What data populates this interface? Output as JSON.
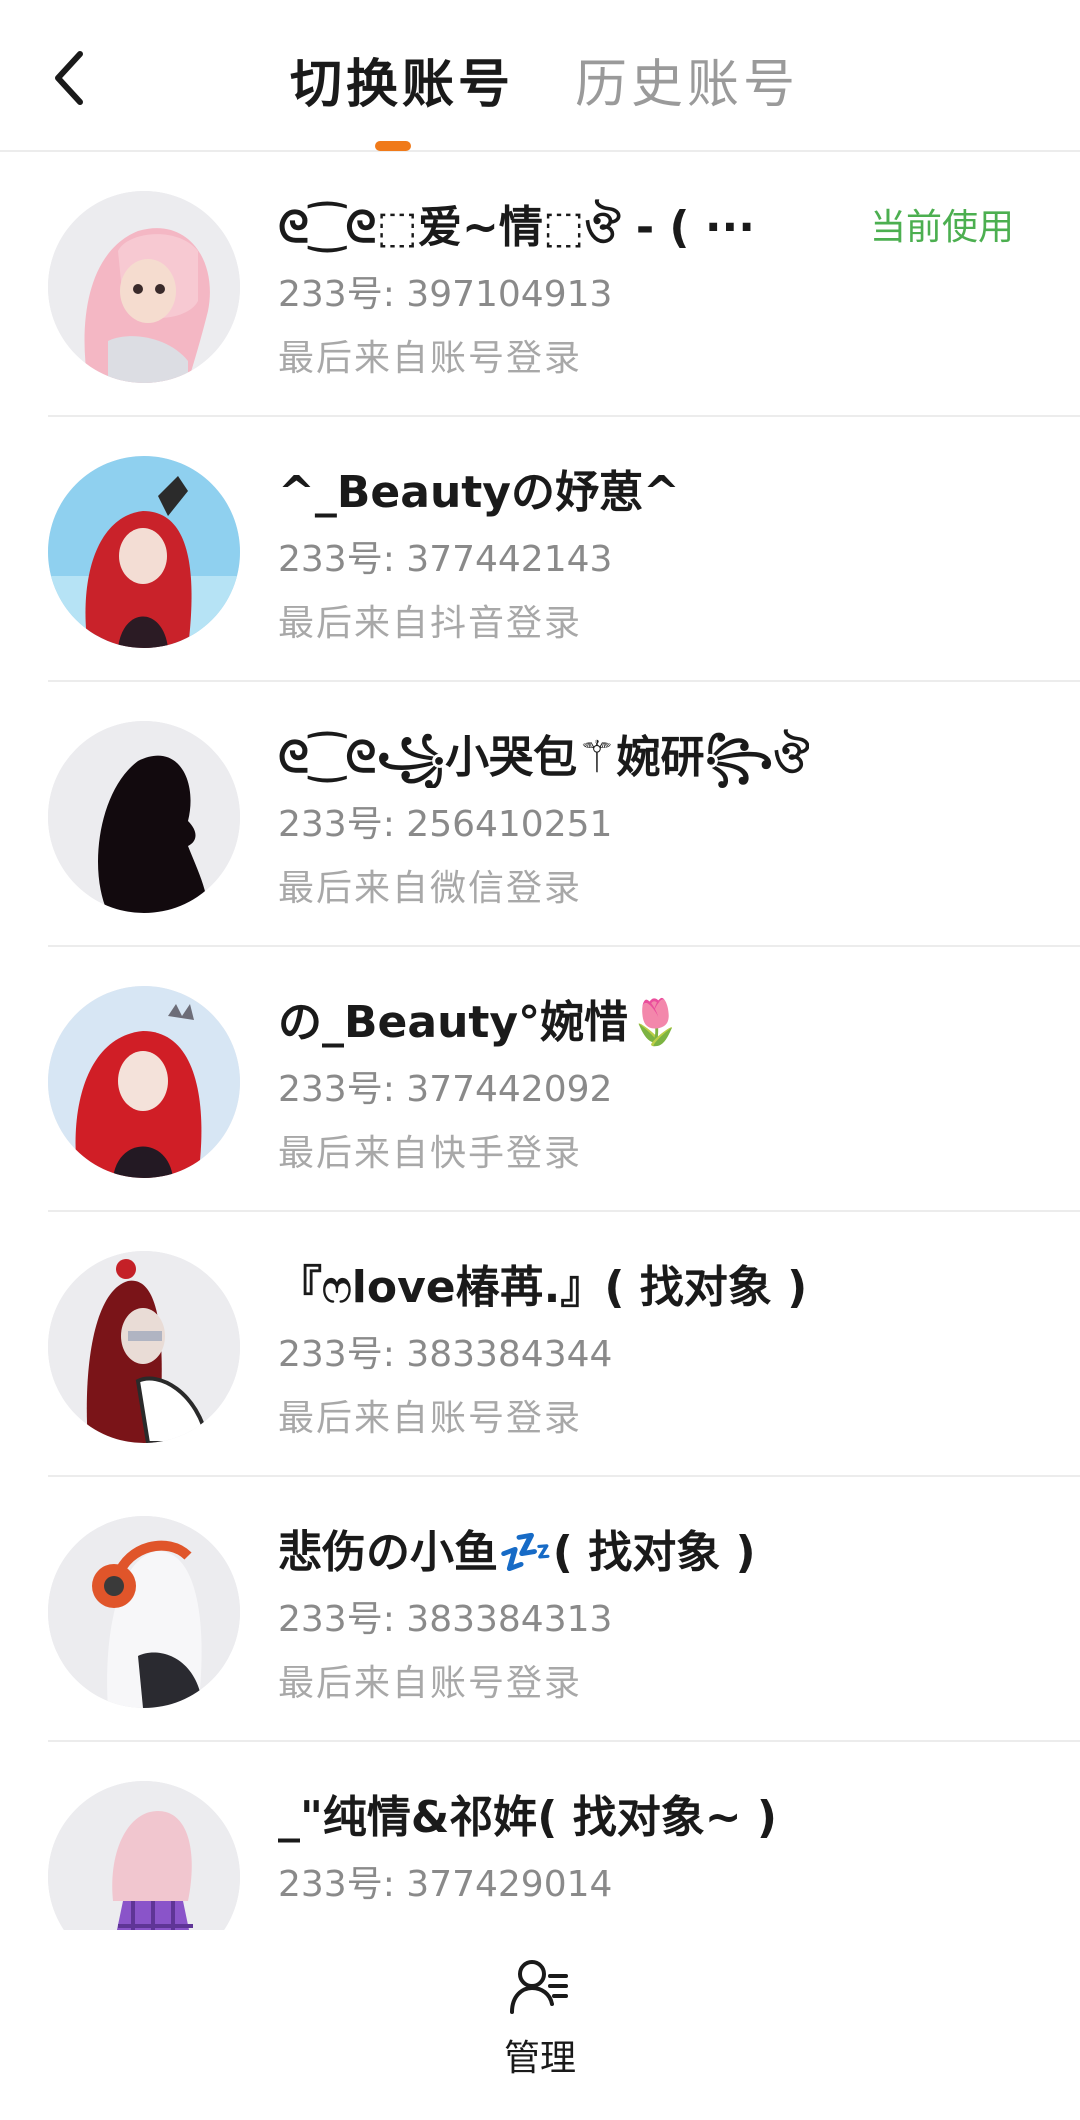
{
  "header": {
    "back_icon": "chevron-left-icon",
    "tabs": [
      {
        "label": "切换账号",
        "active": true
      },
      {
        "label": "历史账号",
        "active": false
      }
    ],
    "accent_color": "#f07a1a"
  },
  "accounts": [
    {
      "nickname": "ᘓ⁐ᘓ⬚爱~情⬚ঔ - ( ···",
      "uid": "233号: 397104913",
      "login_source": "最后来自账号登录",
      "badge": "当前使用",
      "avatar_icon": "pink-hair-avatar"
    },
    {
      "nickname": "^_Beautyの妤葸^",
      "uid": "233号: 377442143",
      "login_source": "最后来自抖音登录",
      "badge": "",
      "avatar_icon": "red-hair-avatar"
    },
    {
      "nickname": "ᘓ⁐ᘓ꧁小哭包⚚婉研꧂ঔ",
      "uid": "233号: 256410251",
      "login_source": "最后来自微信登录",
      "badge": "",
      "avatar_icon": "silhouette-avatar"
    },
    {
      "nickname": "の_Beauty°婉惜🌷",
      "uid": "233号: 377442092",
      "login_source": "最后来自快手登录",
      "badge": "",
      "avatar_icon": "red-hair-crown-avatar"
    },
    {
      "nickname": "『ෆlove椿苒.』( 找对象 )",
      "uid": "233号: 383384344",
      "login_source": "最后来自账号登录",
      "badge": "",
      "avatar_icon": "dark-red-ponytail-avatar"
    },
    {
      "nickname": "悲伤の小鱼💤( 找对象 )",
      "uid": "233号: 383384313",
      "login_source": "最后来自账号登录",
      "badge": "",
      "avatar_icon": "headphones-avatar"
    },
    {
      "nickname": "_\"纯情&祁姩( 找对象~ )",
      "uid": "233号: 377429014",
      "login_source": "",
      "badge": "",
      "avatar_icon": "purple-plaid-avatar"
    }
  ],
  "bottom_bar": {
    "manage_label": "管理",
    "manage_icon": "user-manage-icon"
  },
  "colors": {
    "current_badge": "#4caf50",
    "divider": "#ececec"
  }
}
